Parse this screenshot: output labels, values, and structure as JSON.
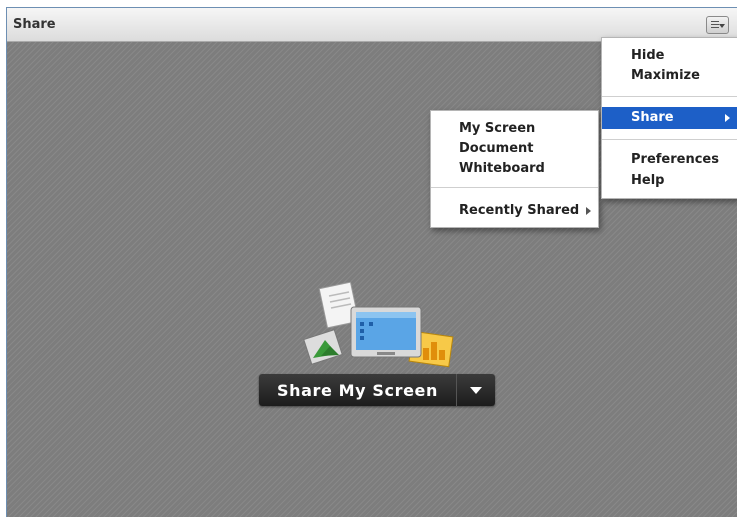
{
  "pod": {
    "title": "Share",
    "menu_button_icon": "pod-options-menu-icon"
  },
  "stage": {
    "share_button_label": "Share My Screen",
    "share_dropdown_icon": "triangle-down-icon",
    "illustration_icon": "share-content-illustration-icon"
  },
  "pod_menu": {
    "items": [
      {
        "label": "Hide"
      },
      {
        "label": "Maximize"
      },
      {
        "label": "Share",
        "selected": true,
        "submenu": true
      },
      {
        "label": "Preferences"
      },
      {
        "label": "Help"
      }
    ]
  },
  "share_submenu": {
    "items": [
      {
        "label": "My Screen"
      },
      {
        "label": "Document"
      },
      {
        "label": "Whiteboard"
      },
      {
        "label": "Recently Shared",
        "submenu": true
      }
    ]
  },
  "colors": {
    "selection": "#1d5fc7",
    "stage": "#808080",
    "button": "#1c1c1c"
  }
}
